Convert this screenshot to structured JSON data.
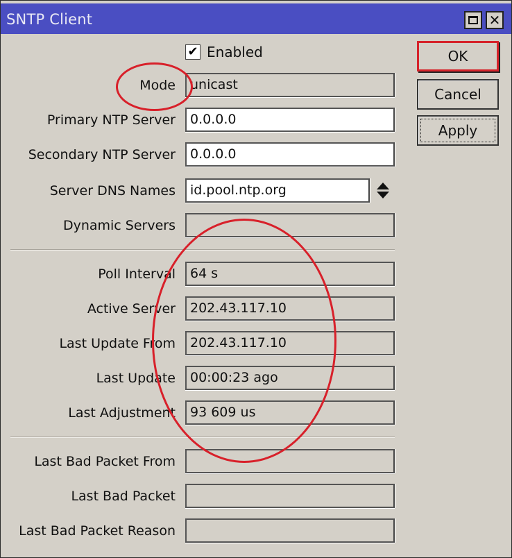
{
  "window": {
    "title": "SNTP Client",
    "controls": {
      "maximize": "maximize-icon",
      "close": "close-icon"
    }
  },
  "enabled": {
    "label": "Enabled",
    "checked": true,
    "check_glyph": "✔"
  },
  "fields": {
    "mode": {
      "label": "Mode",
      "value": "unicast"
    },
    "primary_ntp_server": {
      "label": "Primary NTP Server",
      "value": "0.0.0.0"
    },
    "secondary_ntp_server": {
      "label": "Secondary NTP Server",
      "value": "0.0.0.0"
    },
    "server_dns_names": {
      "label": "Server DNS Names",
      "value": "id.pool.ntp.org"
    },
    "dynamic_servers": {
      "label": "Dynamic Servers",
      "value": ""
    },
    "poll_interval": {
      "label": "Poll Interval",
      "value": "64 s"
    },
    "active_server": {
      "label": "Active Server",
      "value": "202.43.117.10"
    },
    "last_update_from": {
      "label": "Last Update From",
      "value": "202.43.117.10"
    },
    "last_update": {
      "label": "Last Update",
      "value": "00:00:23 ago"
    },
    "last_adjustment": {
      "label": "Last Adjustment",
      "value": "93 609 us"
    },
    "last_bad_packet_from": {
      "label": "Last Bad Packet From",
      "value": ""
    },
    "last_bad_packet": {
      "label": "Last Bad Packet",
      "value": ""
    },
    "last_bad_packet_reason": {
      "label": "Last Bad Packet Reason",
      "value": ""
    }
  },
  "buttons": {
    "ok": "OK",
    "cancel": "Cancel",
    "apply": "Apply"
  },
  "colors": {
    "titlebar": "#4a4ec2",
    "annotation": "#d8202a",
    "background": "#d4d0c8"
  }
}
